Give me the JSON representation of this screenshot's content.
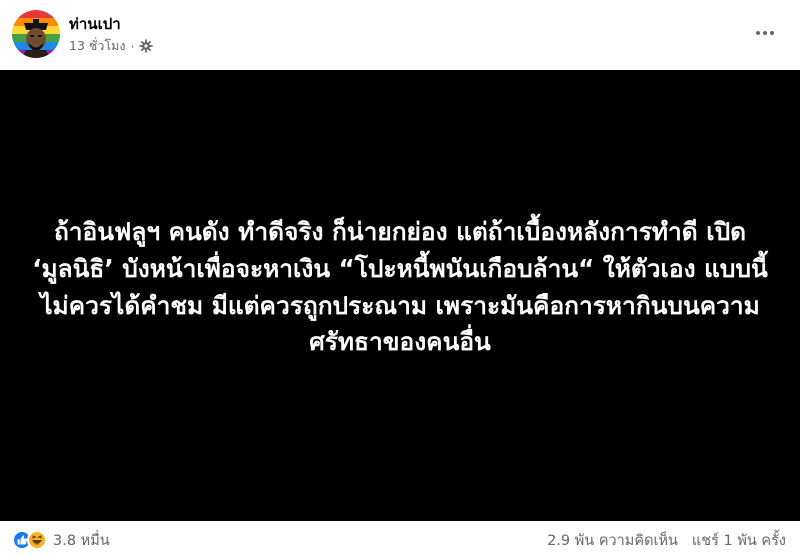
{
  "post": {
    "author": "ท่านเปา",
    "time": "13 ชั่วโมง",
    "separator": "·",
    "text": "ถ้าอินฟลูฯ คนดัง ทำดีจริง ก็น่ายกย่อง แต่ถ้าเบื้องหลังการทำดี เปิด ‘มูลนิธิ’ บังหน้าเพื่อจะหาเงิน “โปะหนี้พนันเกือบล้าน“ ให้ตัวเอง แบบนี้ไม่ควรได้คำชม มีแต่ควรถูกประณาม เพราะมันคือการหากินบนความศรัทธาของคนอื่น",
    "card_background": "#000000",
    "text_color": "#ffffff"
  },
  "icons": {
    "privacy": "gear-icon",
    "more": "more-options-icon",
    "reactions": [
      "like-icon",
      "haha-icon"
    ]
  },
  "footer": {
    "reaction_count": "3.8 หมื่น",
    "comments": "2.9 พัน ความคิดเห็น",
    "shares": "แชร์ 1 พัน ครั้ง"
  },
  "colors": {
    "like": "#1877f2",
    "haha": "#f7b125",
    "meta_text": "#65676b"
  }
}
